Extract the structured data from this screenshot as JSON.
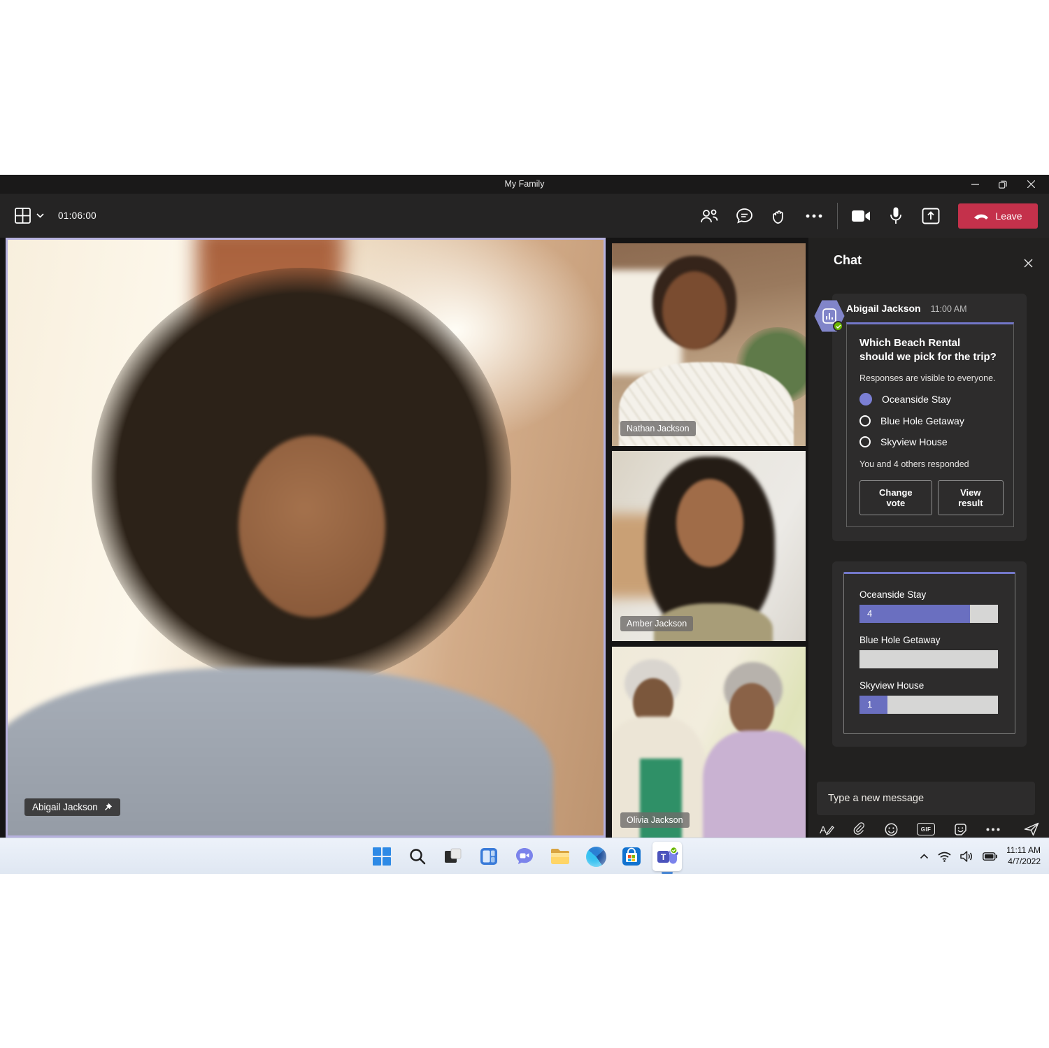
{
  "window": {
    "title": "My Family"
  },
  "toolbar": {
    "timer": "01:06:00",
    "leave_label": "Leave"
  },
  "stage": {
    "main_label": "Abigail Jackson",
    "participants": [
      {
        "name": "Nathan Jackson"
      },
      {
        "name": "Amber Jackson"
      },
      {
        "name": "Olivia Jackson"
      }
    ]
  },
  "chat": {
    "header": "Chat",
    "message": {
      "author": "Abigail Jackson",
      "time": "11:00 AM"
    },
    "poll": {
      "question": "Which Beach Rental should we pick for the trip?",
      "subtitle": "Responses are visible to everyone.",
      "options": [
        {
          "label": "Oceanside Stay",
          "selected": true
        },
        {
          "label": "Blue Hole Getaway",
          "selected": false
        },
        {
          "label": "Skyview House",
          "selected": false
        }
      ],
      "responded": "You and 4 others responded",
      "change_vote_label": "Change vote",
      "view_result_label": "View result"
    },
    "results": {
      "type": "bar",
      "total_responses": 5,
      "options": [
        {
          "label": "Oceanside Stay",
          "votes": 4,
          "votes_label": "4",
          "pct": 80
        },
        {
          "label": "Blue Hole Getaway",
          "votes": 0,
          "votes_label": "",
          "pct": 0
        },
        {
          "label": "Skyview House",
          "votes": 1,
          "votes_label": "1",
          "pct": 20
        }
      ]
    },
    "composer": {
      "placeholder": "Type a new message",
      "gif_label": "GIF"
    }
  },
  "taskbar": {
    "time": "11:11 AM",
    "date": "4/7/2022"
  },
  "colors": {
    "accent_purple": "#7377c9",
    "bar_purple": "#6a6fc0",
    "selected_radio": "#7b7fd4",
    "leave_red": "#c4314b",
    "active_speaker_border": "#b6b1de",
    "presence_green": "#6bb700",
    "taskbar_bg": "#e9eef7"
  },
  "icons": {
    "grid_view": "2x2-grid",
    "chevron_down": "v",
    "participants": "two-people",
    "chat_bubble": "speech-bubble",
    "raise_hand": "hand",
    "more": "ellipsis",
    "camera": "video-camera",
    "mic": "microphone",
    "share": "box-up-arrow",
    "leave": "phone-handset",
    "minimize": "dash",
    "restore": "two-squares",
    "close": "x",
    "pin": "pushpin",
    "poll_avatar": "bar-chart-hexagon",
    "format": "A-pen",
    "attach": "paperclip",
    "emoji": "smiley",
    "gif": "GIF-chip",
    "sticker": "sticker-smile",
    "send": "paper-plane",
    "start": "windows-logo",
    "search": "magnifier",
    "task_view": "overlapping-squares",
    "widgets": "blue-panel",
    "chat_app": "video-bubble",
    "explorer": "folder",
    "edge": "swirl-circle",
    "store": "shopping-bag",
    "teams": "teams-logo",
    "tray_chevron": "caret-up",
    "wifi": "wifi-arcs",
    "volume": "speaker-waves",
    "battery": "battery"
  }
}
